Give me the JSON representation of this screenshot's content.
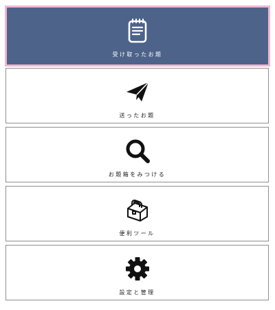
{
  "menu": {
    "items": [
      {
        "label": "受け取ったお題",
        "icon": "notepad-icon",
        "active": true
      },
      {
        "label": "送ったお題",
        "icon": "paper-plane-icon",
        "active": false
      },
      {
        "label": "お題箱をみつける",
        "icon": "magnifier-icon",
        "active": false
      },
      {
        "label": "便利ツール",
        "icon": "toolbox-icon",
        "active": false
      },
      {
        "label": "設定と管理",
        "icon": "gear-icon",
        "active": false
      }
    ]
  },
  "colors": {
    "active_background": "#4e6389",
    "active_outline": "#f1b6cf",
    "border": "#8e8e8e",
    "icon": "#111111"
  }
}
